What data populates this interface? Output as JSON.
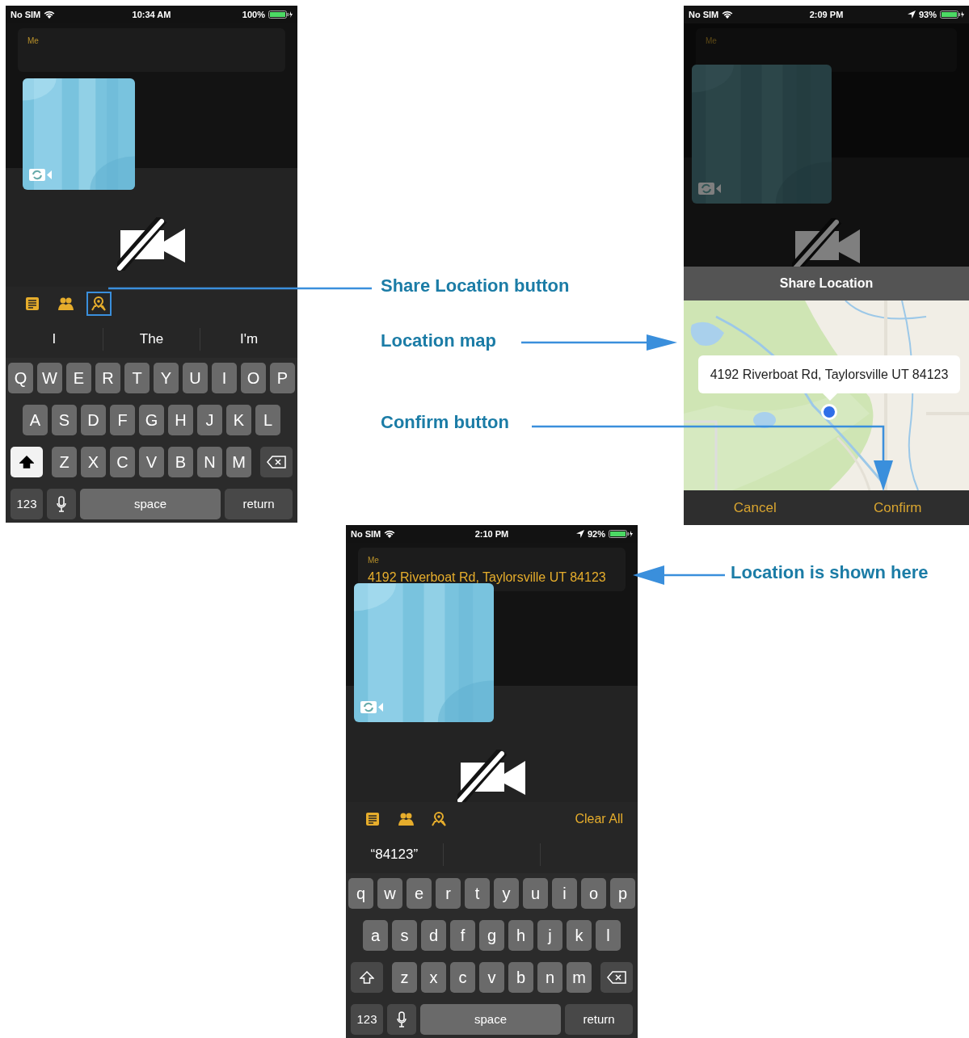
{
  "screens": [
    {
      "kind": "compose",
      "dimmed": false,
      "status_bar": {
        "carrier": "No SIM",
        "time": "10:34 AM",
        "location_arrow": false,
        "battery": "100%"
      },
      "message": {
        "sender": "Me"
      },
      "toolbar": {
        "tools": [
          {
            "highlighted": false
          },
          {
            "highlighted": false
          },
          {
            "highlighted": true
          }
        ]
      },
      "suggestions": [
        "I",
        "The",
        "I'm"
      ],
      "keyboard": {
        "rows": [
          [
            "Q",
            "W",
            "E",
            "R",
            "T",
            "Y",
            "U",
            "I",
            "O",
            "P"
          ],
          [
            "A",
            "S",
            "D",
            "F",
            "G",
            "H",
            "J",
            "K",
            "L"
          ],
          [
            "Z",
            "X",
            "C",
            "V",
            "B",
            "N",
            "M"
          ]
        ],
        "shift_on": true,
        "mode_key": "123",
        "space": "space",
        "return": "return"
      }
    },
    {
      "kind": "share",
      "dimmed": true,
      "status_bar": {
        "carrier": "No SIM",
        "time": "2:09 PM",
        "location_arrow": true,
        "battery": "93%"
      },
      "message": {
        "sender": "Me"
      },
      "sheet": {
        "title": "Share Location",
        "address": "4192 Riverboat Rd, Taylorsville UT 84123",
        "buttons": [
          "Cancel",
          "Confirm"
        ]
      }
    },
    {
      "kind": "compose",
      "dimmed": false,
      "status_bar": {
        "carrier": "No SIM",
        "time": "2:10 PM",
        "location_arrow": true,
        "battery": "92%"
      },
      "message": {
        "sender": "Me",
        "text": "4192 Riverboat Rd, Taylorsville UT 84123"
      },
      "toolbar": {
        "tools": [
          {
            "highlighted": false
          },
          {
            "highlighted": false
          },
          {
            "highlighted": false
          }
        ],
        "clear_all": "Clear All"
      },
      "suggestions": [
        "“84123”"
      ],
      "keyboard": {
        "rows": [
          [
            "q",
            "w",
            "e",
            "r",
            "t",
            "y",
            "u",
            "i",
            "o",
            "p"
          ],
          [
            "a",
            "s",
            "d",
            "f",
            "g",
            "h",
            "j",
            "k",
            "l"
          ],
          [
            "z",
            "x",
            "c",
            "v",
            "b",
            "n",
            "m"
          ]
        ],
        "shift_on": false,
        "mode_key": "123",
        "space": "space",
        "return": "return"
      }
    }
  ],
  "callouts": [
    "Share Location button",
    "Location map",
    "Confirm button",
    "Location is shown here"
  ]
}
